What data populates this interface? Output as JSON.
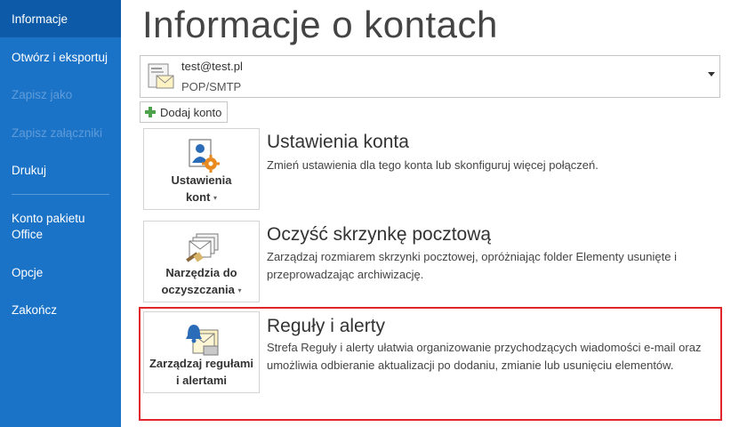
{
  "sidebar": {
    "items": [
      {
        "label": "Informacje",
        "active": true,
        "disabled": false
      },
      {
        "label": "Otwórz i eksportuj",
        "active": false,
        "disabled": false
      },
      {
        "label": "Zapisz jako",
        "active": false,
        "disabled": true
      },
      {
        "label": "Zapisz załączniki",
        "active": false,
        "disabled": true
      },
      {
        "label": "Drukuj",
        "active": false,
        "disabled": false
      },
      {
        "label": "Konto pakietu Office",
        "active": false,
        "disabled": false
      },
      {
        "label": "Opcje",
        "active": false,
        "disabled": false
      },
      {
        "label": "Zakończ",
        "active": false,
        "disabled": false
      }
    ]
  },
  "main": {
    "title": "Informacje o kontach",
    "account": {
      "email": "test@test.pl",
      "type": "POP/SMTP"
    },
    "add_account_label": "Dodaj konto",
    "sections": [
      {
        "tile_label_line1": "Ustawienia",
        "tile_label_line2": "kont",
        "title": "Ustawienia konta",
        "description": "Zmień ustawienia dla tego konta lub skonfiguruj więcej połączeń."
      },
      {
        "tile_label_line1": "Narzędzia do",
        "tile_label_line2": "oczyszczania",
        "title": "Oczyść skrzynkę pocztową",
        "description": "Zarządzaj rozmiarem skrzynki pocztowej, opróżniając folder Elementy usunięte i przeprowadzając archiwizację."
      },
      {
        "tile_label_line1": "Zarządzaj regułami",
        "tile_label_line2": "i alertami",
        "title": "Reguły i alerty",
        "description": "Strefa Reguły i alerty ułatwia organizowanie przychodzących wiadomości e-mail oraz umożliwia odbieranie aktualizacji po dodaniu, zmianie lub usunięciu elementów."
      }
    ]
  },
  "colors": {
    "sidebar_bg": "#1b73c8",
    "sidebar_active": "#0d5ba8",
    "highlight": "#e0252c",
    "accent_gear": "#e88a1f"
  }
}
